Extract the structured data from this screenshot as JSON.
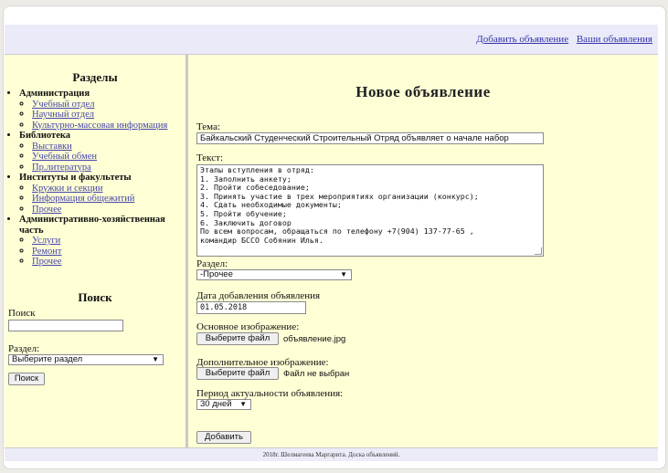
{
  "header": {
    "links": [
      "Добавить объявление",
      "Ваши объявления"
    ]
  },
  "sidebar": {
    "sections_title": "Разделы",
    "categories": [
      {
        "label": "Администрация",
        "items": [
          "Учебный отдел",
          "Научный отдел",
          "Культурно-массовая информация"
        ]
      },
      {
        "label": "Библиотека",
        "items": [
          "Выставки",
          "Учебный обмен",
          "Пр.литература"
        ]
      },
      {
        "label": "Институты и факультеты",
        "items": [
          "Кружки и секции",
          "Информация общежитий",
          "Прочее"
        ]
      },
      {
        "label": "Административно-хозяйственная часть",
        "items": [
          "Услуги",
          "Ремонт",
          "Прочее"
        ]
      }
    ],
    "search": {
      "title": "Поиск",
      "label": "Поиск",
      "value": "",
      "section_label": "Раздел:",
      "section_selected": "Выберите раздел",
      "button": "Поиск"
    }
  },
  "form": {
    "title": "Новое объявление",
    "topic_label": "Тема:",
    "topic_value": "Байкальский Студенческий Строительный Отряд объявляет о начале набор",
    "text_label": "Текст:",
    "text_lines": [
      "Этапы вступления в отряд:",
      "1. Заполнить анкету;",
      "2. Пройти собеседование;",
      "3. Принять участие в трех мероприятиях организации (конкурс);",
      "4. Сдать необходимые документы;",
      "5. Пройти обучение;",
      "6. Заключить договор",
      "По всем вопросам, обращаться по телефону +7(904) 137-77-65 ,",
      "командир БССО Собянин Илья."
    ],
    "section_label": "Раздел:",
    "section_selected": "-Прочее",
    "date_label": "Дата добавления объявления",
    "date_value": "01.05.2018",
    "main_image_label": "Основное изображение:",
    "choose_file": "Выберите файл",
    "main_image_file": "объявление.jpg",
    "extra_image_label": "Дополнительное изображение:",
    "extra_image_file": "Файл не выбран",
    "period_label": "Период актуальности объявления:",
    "period_selected": "30 дней",
    "submit": "Добавить"
  },
  "footer": {
    "text": "2018г. Шелмагеева Маргарита. Доска объявлений."
  }
}
